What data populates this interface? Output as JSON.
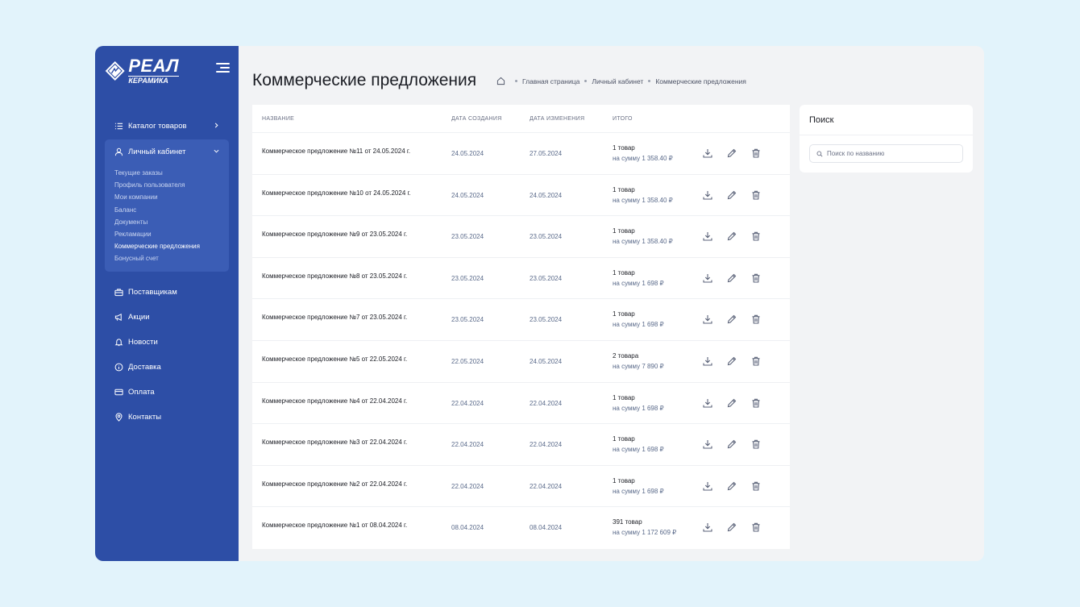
{
  "brand": {
    "line1": "РЕАЛ",
    "line2": "КЕРАМИКА"
  },
  "sidebar": {
    "catalog": "Каталог товаров",
    "account": "Личный кабинет",
    "sub": [
      "Текущие заказы",
      "Профиль пользователя",
      "Мои компании",
      "Баланс",
      "Документы",
      "Рекламации",
      "Коммерческие предложения",
      "Бонусный счет"
    ],
    "suppliers": "Поставщикам",
    "promos": "Акции",
    "news": "Новости",
    "delivery": "Доставка",
    "payment": "Оплата",
    "contacts": "Контакты"
  },
  "header": {
    "title": "Коммерческие предложения",
    "crumbs": [
      "Главная страница",
      "Личный кабинет",
      "Коммерческие предложения"
    ]
  },
  "table": {
    "columns": [
      "НАЗВАНИЕ",
      "ДАТА СОЗДАНИЯ",
      "ДАТА ИЗМЕНЕНИЯ",
      "ИТОГО"
    ],
    "rows": [
      {
        "name": "Коммерческое предложение №11 от 24.05.2024 г.",
        "created": "24.05.2024",
        "modified": "27.05.2024",
        "qty": "1 товар",
        "sum": "на сумму 1 358.40 ₽"
      },
      {
        "name": "Коммерческое предложение №10 от 24.05.2024 г.",
        "created": "24.05.2024",
        "modified": "24.05.2024",
        "qty": "1 товар",
        "sum": "на сумму 1 358.40 ₽"
      },
      {
        "name": "Коммерческое предложение №9 от 23.05.2024 г.",
        "created": "23.05.2024",
        "modified": "23.05.2024",
        "qty": "1 товар",
        "sum": "на сумму 1 358.40 ₽"
      },
      {
        "name": "Коммерческое предложение №8 от 23.05.2024 г.",
        "created": "23.05.2024",
        "modified": "23.05.2024",
        "qty": "1 товар",
        "sum": "на сумму 1 698 ₽"
      },
      {
        "name": "Коммерческое предложение №7 от 23.05.2024 г.",
        "created": "23.05.2024",
        "modified": "23.05.2024",
        "qty": "1 товар",
        "sum": "на сумму 1 698 ₽"
      },
      {
        "name": "Коммерческое предложение №5 от 22.05.2024 г.",
        "created": "22.05.2024",
        "modified": "24.05.2024",
        "qty": "2 товара",
        "sum": "на сумму 7 890 ₽"
      },
      {
        "name": "Коммерческое предложение №4 от 22.04.2024 г.",
        "created": "22.04.2024",
        "modified": "22.04.2024",
        "qty": "1 товар",
        "sum": "на сумму 1 698 ₽"
      },
      {
        "name": "Коммерческое предложение №3 от 22.04.2024 г.",
        "created": "22.04.2024",
        "modified": "22.04.2024",
        "qty": "1 товар",
        "sum": "на сумму 1 698 ₽"
      },
      {
        "name": "Коммерческое предложение №2 от 22.04.2024 г.",
        "created": "22.04.2024",
        "modified": "22.04.2024",
        "qty": "1 товар",
        "sum": "на сумму 1 698 ₽"
      },
      {
        "name": "Коммерческое предложение №1 от 08.04.2024 г.",
        "created": "08.04.2024",
        "modified": "08.04.2024",
        "qty": "391 товар",
        "sum": "на сумму 1 172 609 ₽"
      }
    ]
  },
  "search": {
    "title": "Поиск",
    "placeholder": "Поиск по названию",
    "value": ""
  },
  "icons": {
    "row_actions": [
      "download-icon",
      "edit-icon",
      "trash-icon"
    ]
  },
  "colors": {
    "sidebar": "#2d4ea6",
    "sidebar_group": "#3b5db5",
    "background": "#e2f3fb"
  }
}
